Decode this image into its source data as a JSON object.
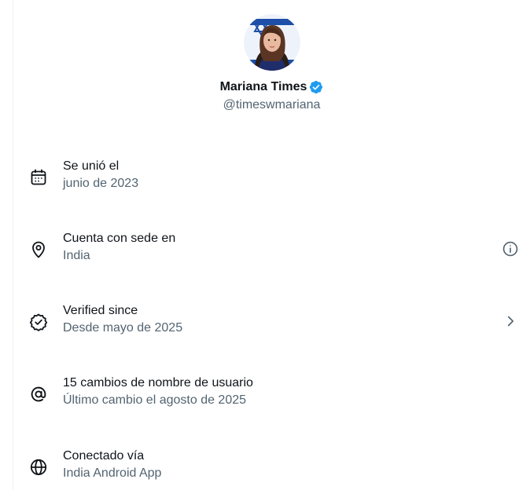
{
  "profile": {
    "display_name": "Mariana Times",
    "handle": "@timeswmariana",
    "verified": true,
    "badge_color": "#1d9bf0",
    "avatar": "avatar-photo-with-flag"
  },
  "about_rows": [
    {
      "icon": "calendar-icon",
      "label": "Se unió el",
      "value": "junio de 2023"
    },
    {
      "icon": "location-pin-icon",
      "label": "Cuenta con sede en",
      "value": "India",
      "trailing_icon": "info-icon"
    },
    {
      "icon": "verified-seal-icon",
      "label": "Verified since",
      "value": "Desde mayo de 2025",
      "trailing_icon": "chevron-right-icon"
    },
    {
      "icon": "at-sign-icon",
      "label": "15 cambios de nombre de usuario",
      "value": "Último cambio el agosto de 2025"
    },
    {
      "icon": "globe-icon",
      "label": "Conectado vía",
      "value": "India Android App"
    }
  ],
  "colors": {
    "primary_text": "#0f1419",
    "secondary_text": "#536471",
    "border": "#eff3f4"
  }
}
